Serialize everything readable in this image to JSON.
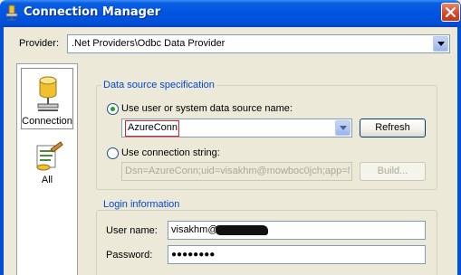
{
  "window": {
    "title": "Connection Manager"
  },
  "provider": {
    "label": "Provider:",
    "value": ".Net Providers\\Odbc Data Provider"
  },
  "nav": {
    "items": [
      {
        "label": "Connection"
      },
      {
        "label": "All"
      }
    ]
  },
  "datasource": {
    "group_title": "Data source specification",
    "dsn_radio_label": "Use user or system data source name:",
    "dsn_value": "AzureConn",
    "refresh_label": "Refresh",
    "connstr_radio_label": "Use connection string:",
    "connstr_value": "Dsn=AzureConn;uid=visakhm@mowboc0jch;app=M",
    "build_label": "Build..."
  },
  "login": {
    "group_title": "Login information",
    "username_label": "User name:",
    "username_value": "visakhm@",
    "password_label": "Password:",
    "password_value": "●●●●●●●●"
  },
  "colors": {
    "titlebar": "#0054e3",
    "accent_text": "#0046d5",
    "highlight_border": "#e02020"
  }
}
